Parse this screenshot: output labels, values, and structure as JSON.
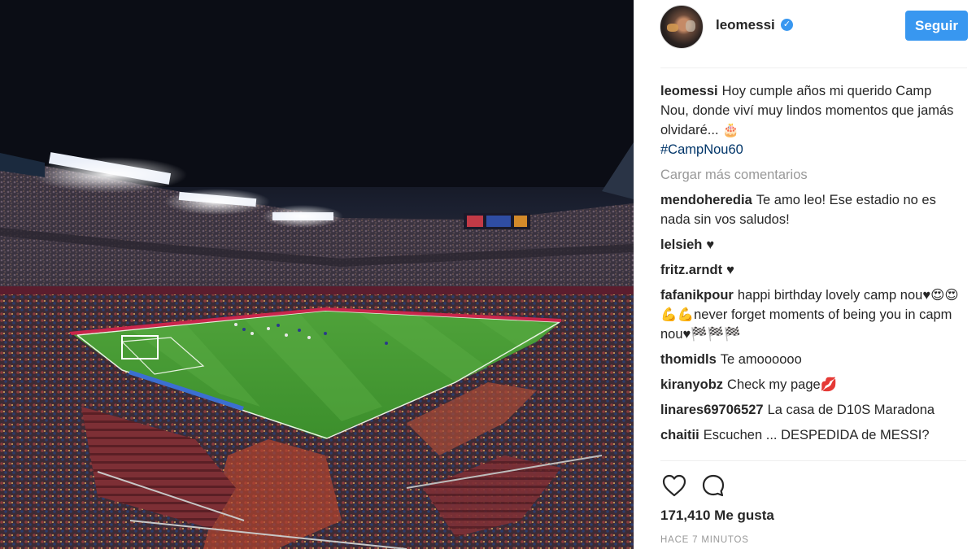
{
  "post": {
    "author": "leomessi",
    "verified": true,
    "follow_label": "Seguir",
    "caption_user": "leomessi",
    "caption_text": "Hoy cumple años mi querido Camp Nou, donde viví muy lindos momentos que jamás olvidaré... 🎂",
    "caption_hashtag": "#CampNou60",
    "load_more": "Cargar más comentarios",
    "likes": "171,410 Me gusta",
    "time": "HACE 7 MINUTOS"
  },
  "comments": [
    {
      "user": "mendoheredia",
      "text": "Te amo leo! Ese estadio no es nada sin vos saludos!"
    },
    {
      "user": "lelsieh",
      "text": "♥"
    },
    {
      "user": "fritz.arndt",
      "text": "♥"
    },
    {
      "user": "fafanikpour",
      "text": "happi birthday lovely camp nou♥😍😍💪💪never forget moments of being you in capm nou♥🏁🏁🏁"
    },
    {
      "user": "thomidls",
      "text": "Te amoooooo"
    },
    {
      "user": "kiranyobz",
      "text": "Check my page💋"
    },
    {
      "user": "linares69706527",
      "text": "La casa de D10S Maradona"
    },
    {
      "user": "chaitii",
      "text": "Escuchen ... DESPEDIDA de MESSI?"
    }
  ],
  "icons": {
    "like": "heart-outline-icon",
    "comment": "speech-bubble-icon",
    "verified": "verified-badge-icon"
  },
  "colors": {
    "accent": "#3897f0",
    "hashtag": "#003569",
    "muted": "#999999"
  }
}
